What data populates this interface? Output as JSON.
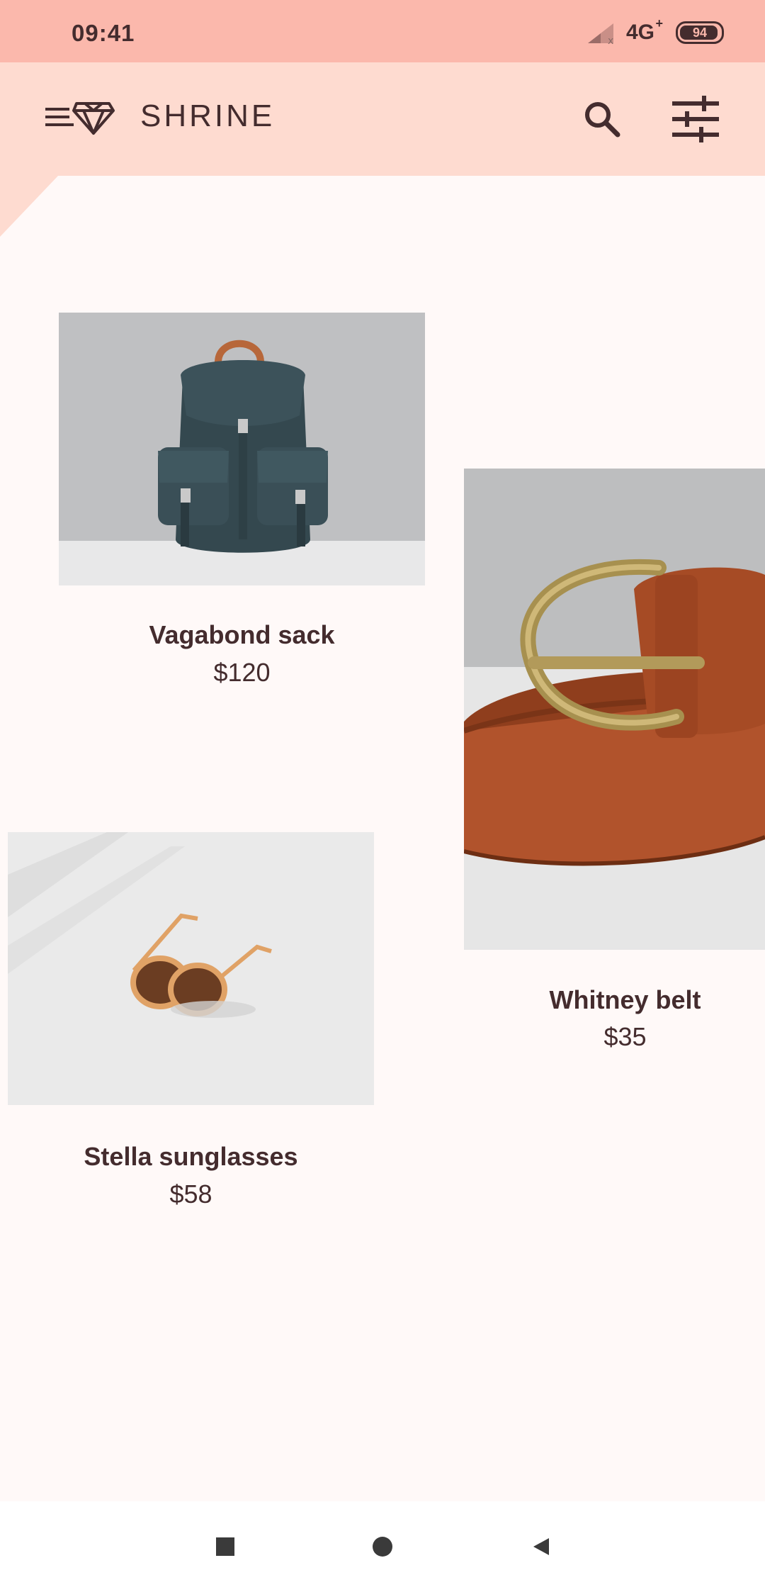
{
  "status_bar": {
    "time": "09:41",
    "network": "4G",
    "network_suffix": "+",
    "battery": "94"
  },
  "app_bar": {
    "title": "SHRINE",
    "icons": [
      "menu-diamond-icon",
      "search-icon",
      "filter-icon"
    ]
  },
  "products": [
    {
      "name": "Vagabond sack",
      "price": "$120",
      "image": "backpack"
    },
    {
      "name": "Whitney belt",
      "price": "$35",
      "image": "belt"
    },
    {
      "name": "Stella sunglasses",
      "price": "$58",
      "image": "sunglasses"
    }
  ],
  "nav_bar": {
    "icons": [
      "recents-square-icon",
      "home-circle-icon",
      "back-triangle-icon"
    ]
  },
  "colors": {
    "status_bar": "#fbb8ac",
    "app_bar": "#fedbd0",
    "background": "#fff9f8",
    "text": "#442c2e"
  }
}
